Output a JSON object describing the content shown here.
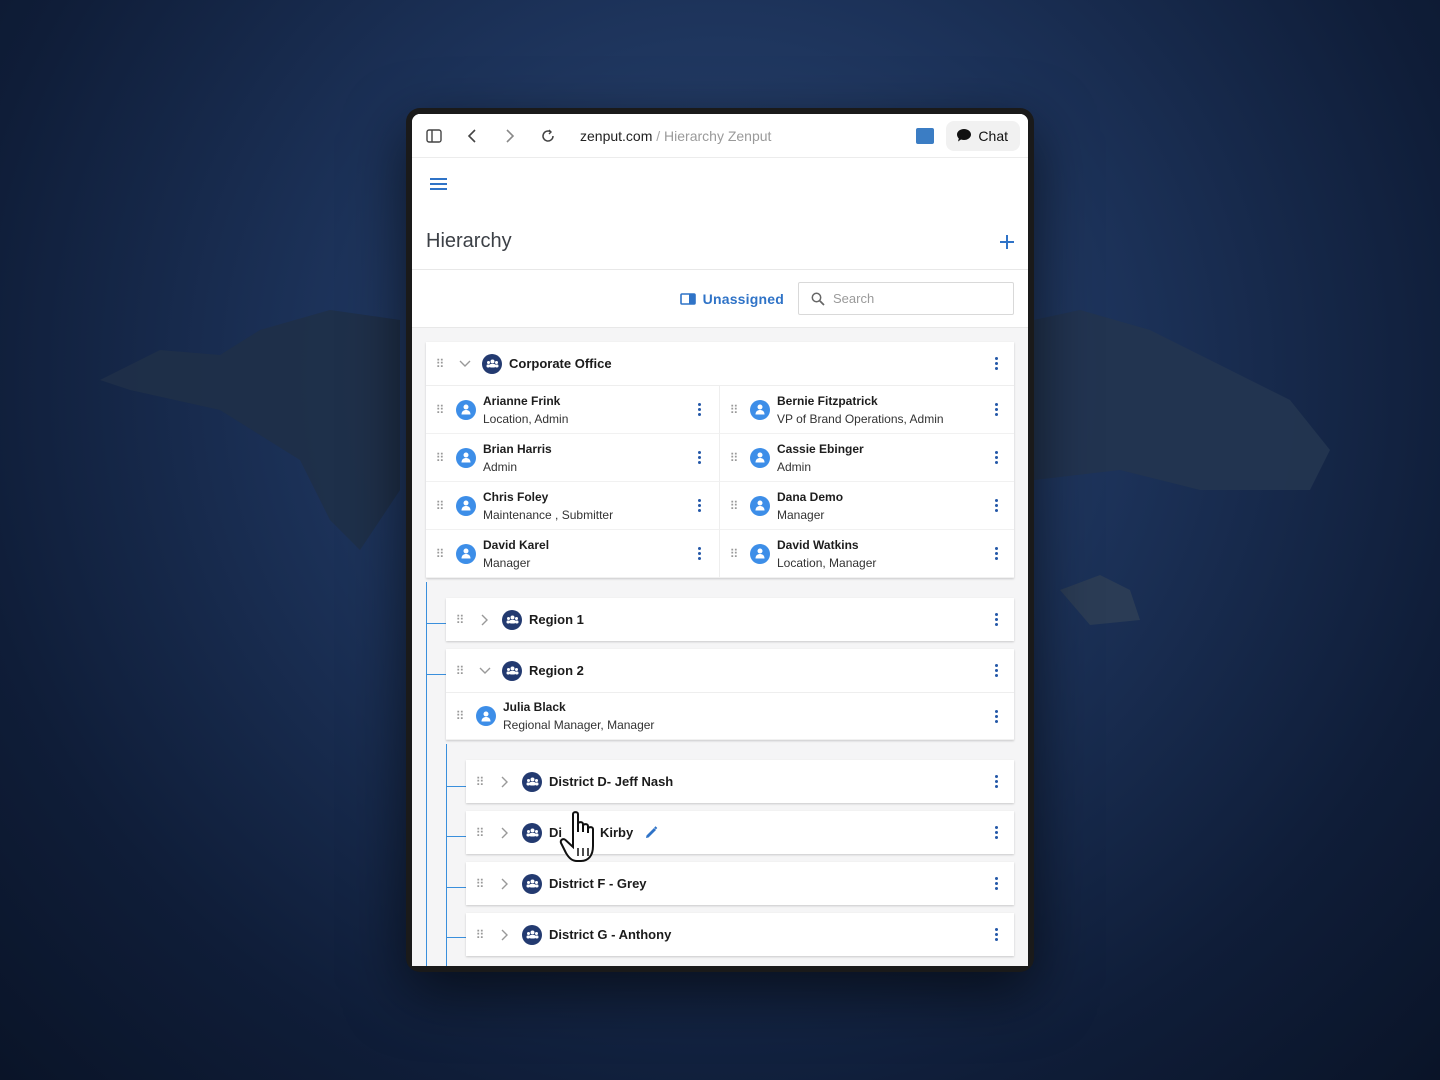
{
  "browser": {
    "domain": "zenput.com",
    "separator": " / ",
    "page": "Hierarchy Zenput",
    "chat_label": "Chat"
  },
  "header": {
    "title": "Hierarchy"
  },
  "toolbar": {
    "unassigned_label": "Unassigned",
    "search_placeholder": "Search"
  },
  "corporate": {
    "name": "Corporate Office",
    "members": [
      {
        "name": "Arianne Frink",
        "role": "Location, Admin"
      },
      {
        "name": "Bernie Fitzpatrick",
        "role": "VP of Brand Operations, Admin"
      },
      {
        "name": "Brian Harris",
        "role": "Admin"
      },
      {
        "name": "Cassie Ebinger",
        "role": "Admin"
      },
      {
        "name": "Chris Foley",
        "role": "Maintenance , Submitter"
      },
      {
        "name": "Dana Demo",
        "role": "Manager"
      },
      {
        "name": "David Karel",
        "role": "Manager"
      },
      {
        "name": "David Watkins",
        "role": "Location, Manager"
      }
    ]
  },
  "regions": [
    {
      "name": "Region 1"
    },
    {
      "name": "Region 2",
      "members": [
        {
          "name": "Julia Black",
          "role": "Regional Manager, Manager"
        }
      ]
    }
  ],
  "districts": [
    {
      "name": "District D- Jeff Nash"
    },
    {
      "name_visible_start": "Di",
      "name_visible_end": "Kirby"
    },
    {
      "name": "District F - Grey"
    },
    {
      "name": "District G - Anthony"
    }
  ],
  "colors": {
    "accent": "#2f73c7",
    "group_icon": "#233a70",
    "user_icon": "#3d8ee8",
    "tree_line": "#3a8fdc"
  }
}
